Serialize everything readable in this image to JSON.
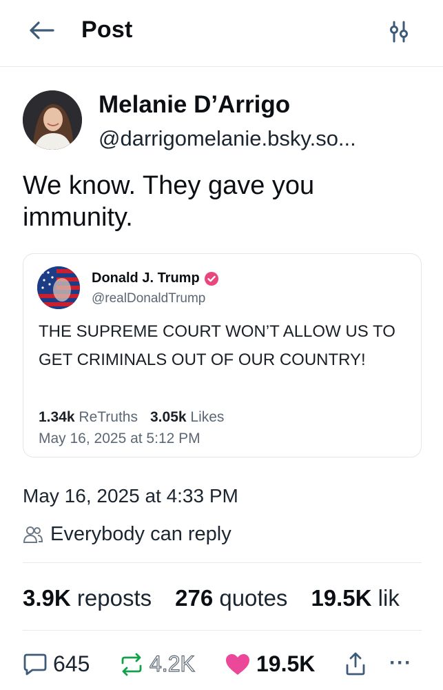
{
  "header": {
    "title": "Post"
  },
  "author": {
    "name": "Melanie D’Arrigo",
    "handle": "@darrigomelanie.bsky.so..."
  },
  "post": {
    "text": "We know. They gave you immunity.",
    "timestamp": "May 16, 2025 at 4:33 PM",
    "reply_setting": "Everybody can reply"
  },
  "quoted_post": {
    "author_name": "Donald J. Trump",
    "author_handle": "@realDonaldTrump",
    "text": "THE SUPREME COURT WON’T ALLOW US TO GET CRIMINALS OUT OF OUR COUNTRY!",
    "retruths_count": "1.34k",
    "retruths_label": "ReTruths",
    "likes_count": "3.05k",
    "likes_label": "Likes",
    "timestamp": "May 16, 2025 at 5:12 PM"
  },
  "counts": {
    "reposts_value": "3.9K",
    "reposts_label": "reposts",
    "quotes_value": "276",
    "quotes_label": "quotes",
    "likes_value": "19.5K",
    "likes_label": "lik"
  },
  "actions": {
    "reply_count": "645",
    "repost_count": "4.2K",
    "like_count": "19.5K",
    "more_label": "···"
  },
  "colors": {
    "like_pink": "#ec4899",
    "repost_green": "#13a04a",
    "verified_pink": "#e8467c"
  }
}
